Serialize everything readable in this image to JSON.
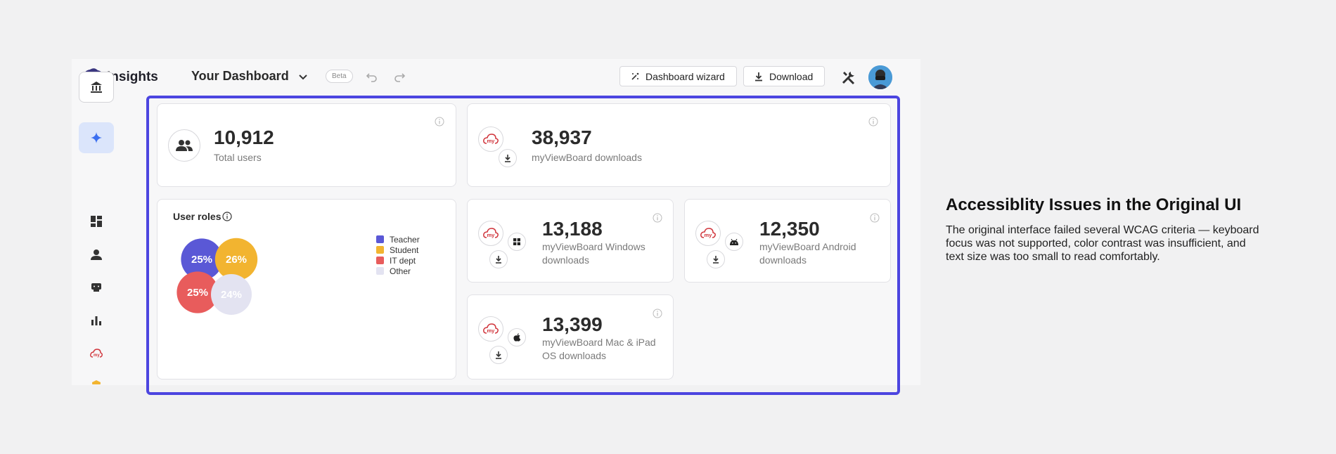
{
  "app": {
    "name": "Insights",
    "dashboard_title": "Your Dashboard",
    "beta_label": "Beta"
  },
  "toolbar": {
    "wizard_label": "Dashboard wizard",
    "download_label": "Download"
  },
  "sidebar": {
    "items": [
      {
        "icon": "bank-icon"
      },
      {
        "icon": "sparkle-icon",
        "active": true
      },
      {
        "icon": "dashboard-icon"
      },
      {
        "icon": "user-icon"
      },
      {
        "icon": "chat-icon"
      },
      {
        "icon": "bar-chart-icon"
      },
      {
        "icon": "myviewboard-icon"
      },
      {
        "icon": "shield-icon"
      }
    ]
  },
  "cards": {
    "total_users": {
      "value": "10,912",
      "label": "Total users"
    },
    "mvb_downloads": {
      "value": "38,937",
      "label": "myViewBoard downloads"
    },
    "windows": {
      "value": "13,188",
      "label": "myViewBoard Windows downloads"
    },
    "android": {
      "value": "12,350",
      "label": "myViewBoard Android downloads"
    },
    "mac": {
      "value": "13,399",
      "label": "myViewBoard Mac & iPad OS downloads"
    },
    "user_roles": {
      "title": "User roles"
    }
  },
  "chart_data": {
    "type": "bubble",
    "title": "User roles",
    "series": [
      {
        "name": "Teacher",
        "value": 25,
        "label": "25%",
        "color": "#5a58d6"
      },
      {
        "name": "Student",
        "value": 26,
        "label": "26%",
        "color": "#f2b430"
      },
      {
        "name": "IT dept",
        "value": 25,
        "label": "25%",
        "color": "#e85c5c"
      },
      {
        "name": "Other",
        "value": 24,
        "label": "24%",
        "color": "#e3e3f1"
      }
    ]
  },
  "side_panel": {
    "heading": "Accessiblity Issues in the Original UI",
    "body": "The original interface failed several WCAG criteria — keyboard focus was not supported, color contrast was insufficient, and text size was too small to read comfortably."
  },
  "colors": {
    "focus_ring": "#4c45e0",
    "accent": "#3b6ff0",
    "brand_red": "#d0333a"
  }
}
